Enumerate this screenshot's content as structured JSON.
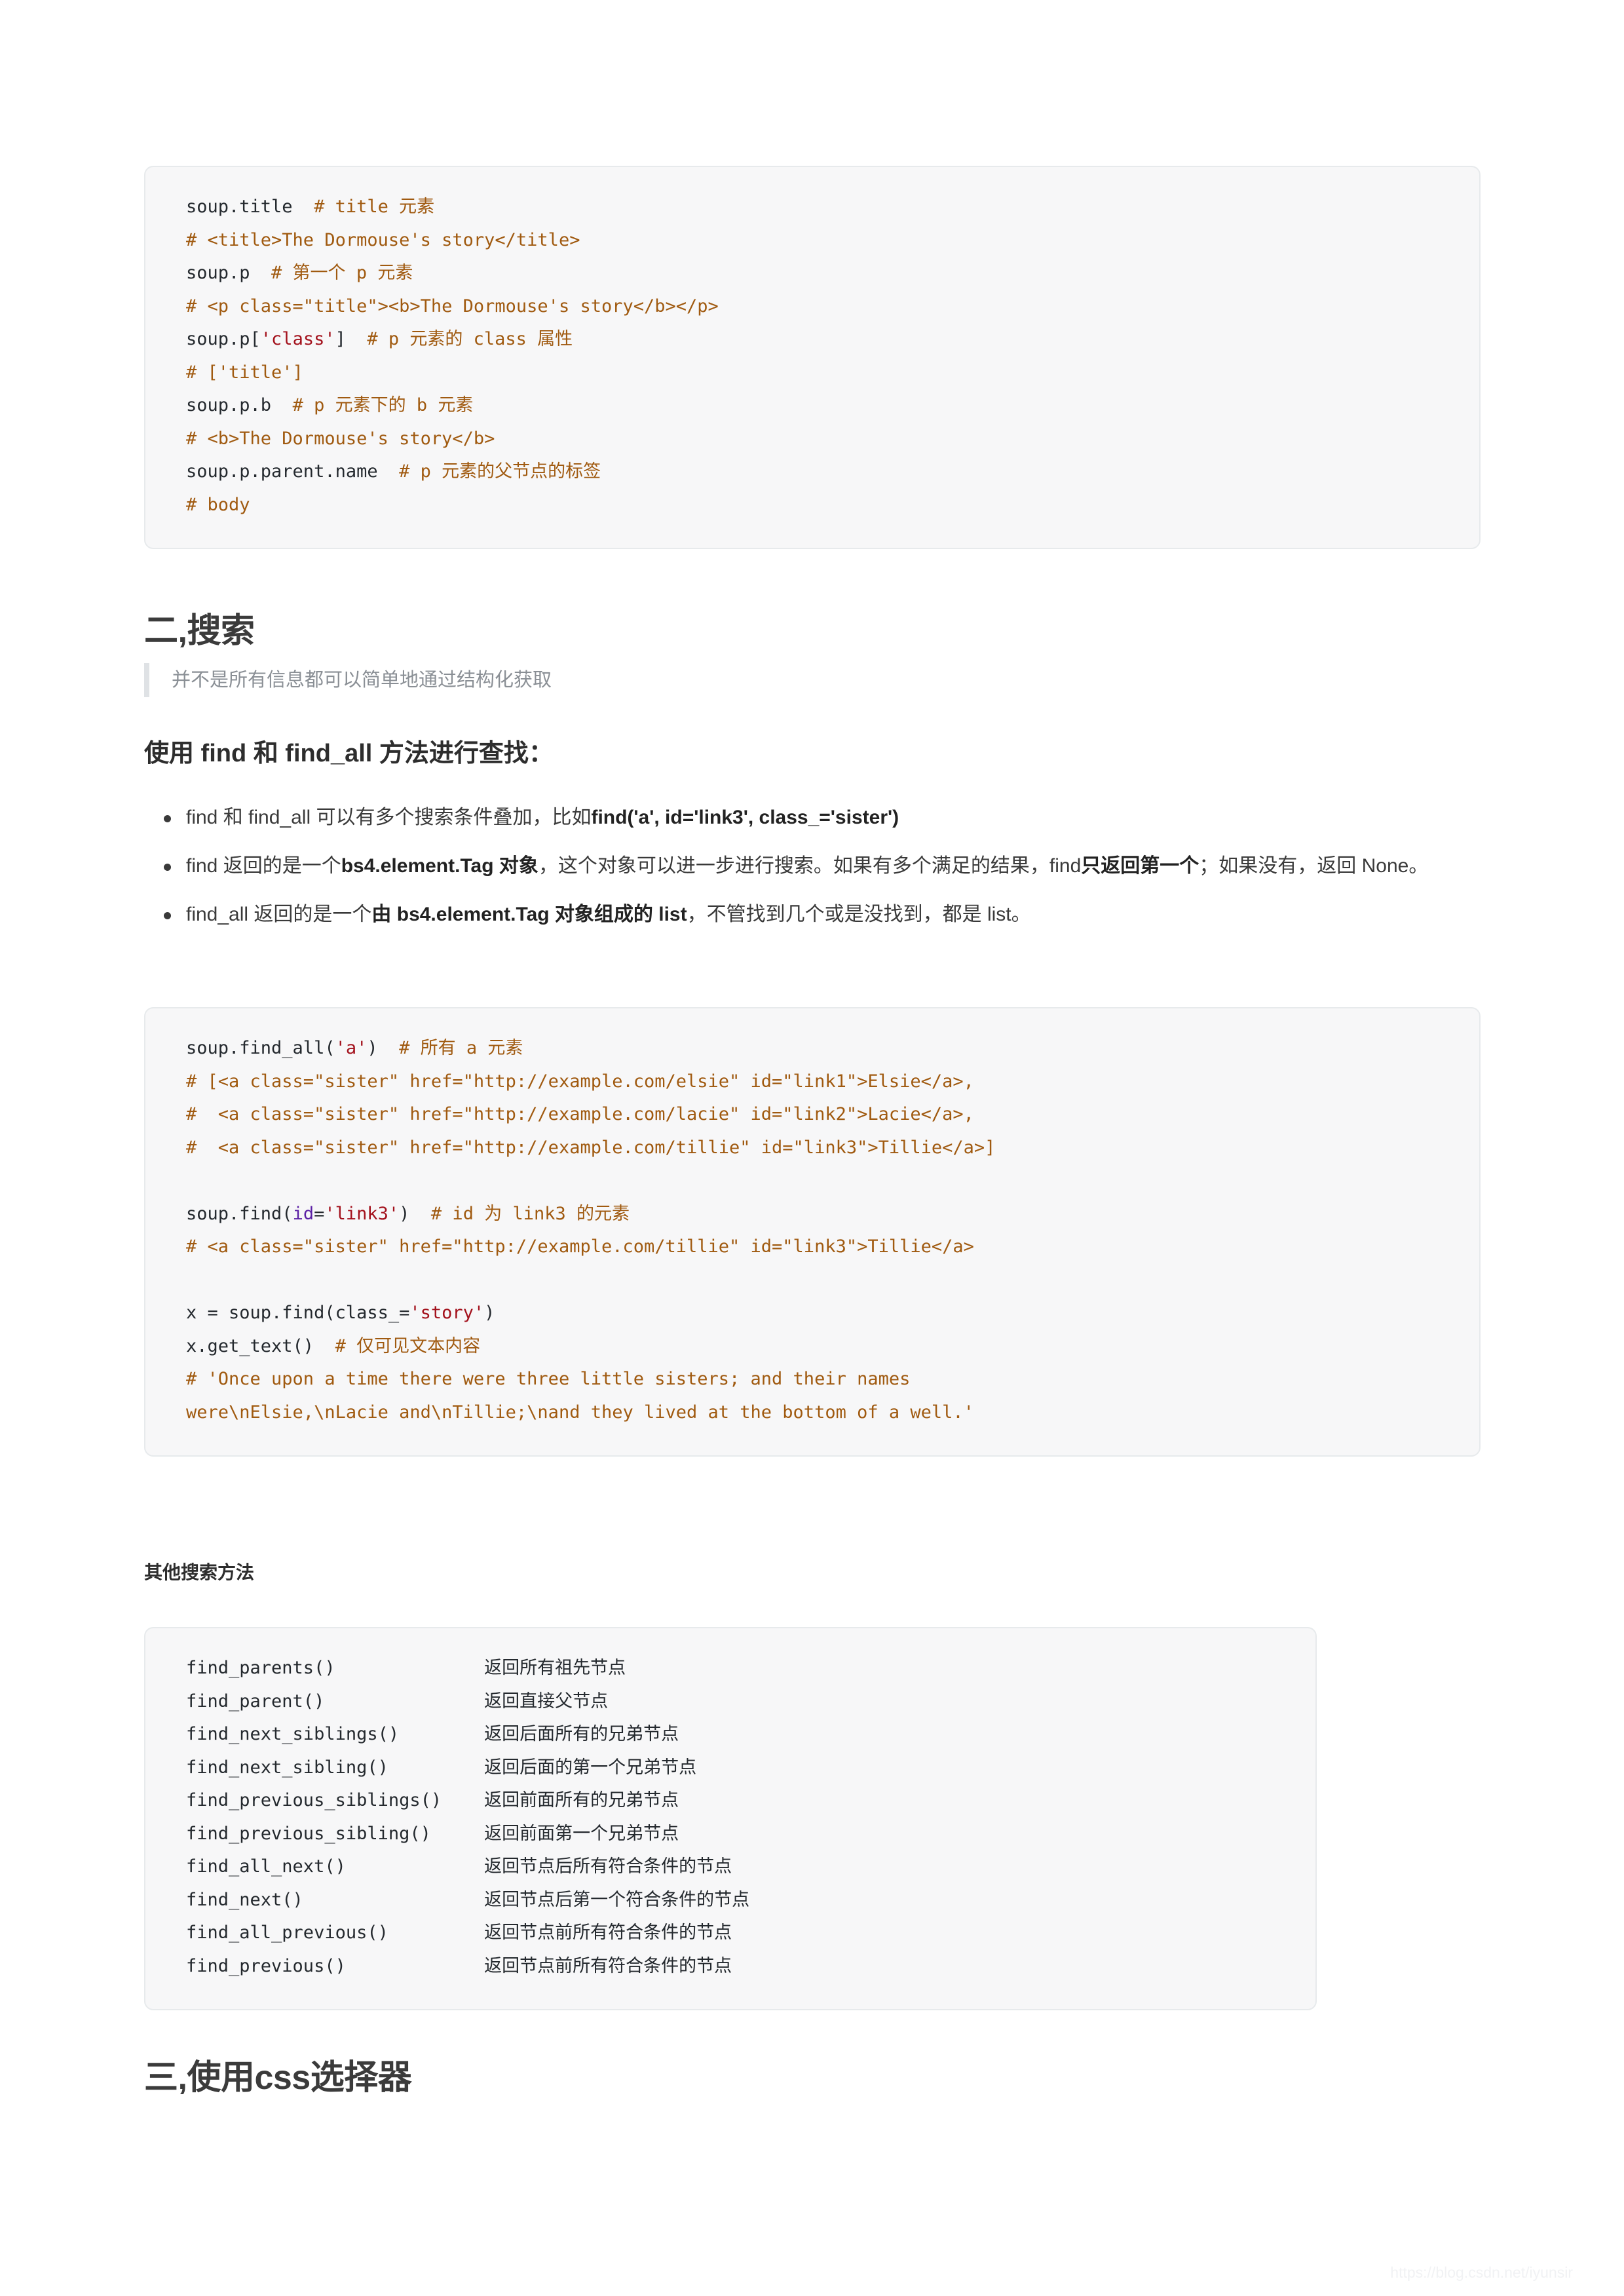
{
  "code_block_1": {
    "lines": [
      [
        {
          "t": "soup.title  ",
          "c": "plain"
        },
        {
          "t": "# title 元素",
          "c": "comment"
        }
      ],
      [
        {
          "t": "# <title>The Dormouse's story</title>",
          "c": "comment"
        }
      ],
      [
        {
          "t": "soup.p  ",
          "c": "plain"
        },
        {
          "t": "# 第一个 p 元素",
          "c": "comment"
        }
      ],
      [
        {
          "t": "# <p class=\"title\"><b>The Dormouse's story</b></p>",
          "c": "comment"
        }
      ],
      [
        {
          "t": "soup.p[",
          "c": "plain"
        },
        {
          "t": "'class'",
          "c": "string"
        },
        {
          "t": "]  ",
          "c": "plain"
        },
        {
          "t": "# p 元素的 class 属性",
          "c": "comment"
        }
      ],
      [
        {
          "t": "# ['title']",
          "c": "comment"
        }
      ],
      [
        {
          "t": "soup.p.b  ",
          "c": "plain"
        },
        {
          "t": "# p 元素下的 b 元素",
          "c": "comment"
        }
      ],
      [
        {
          "t": "# <b>The Dormouse's story</b>",
          "c": "comment"
        }
      ],
      [
        {
          "t": "soup.p.parent.name  ",
          "c": "plain"
        },
        {
          "t": "# p 元素的父节点的标签",
          "c": "comment"
        }
      ],
      [
        {
          "t": "# body",
          "c": "comment"
        }
      ]
    ]
  },
  "section_two": {
    "heading": "二,搜索",
    "quote": "并不是所有信息都可以简单地通过结构化获取",
    "sub_heading": "使用 find 和 find_all 方法进行查找："
  },
  "bullets": [
    [
      {
        "t": "find 和 find_all 可以有多个搜索条件叠加，比如",
        "b": false
      },
      {
        "t": "find('a', id='link3', class_='sister')",
        "b": true
      }
    ],
    [
      {
        "t": "find 返回的是一个",
        "b": false
      },
      {
        "t": "bs4.element.Tag 对象",
        "b": true
      },
      {
        "t": "，这个对象可以进一步进行搜索。如果有多个满足的结果，find",
        "b": false
      },
      {
        "t": "只返回第一个",
        "b": true
      },
      {
        "t": "；如果没有，返回 None。",
        "b": false
      }
    ],
    [
      {
        "t": "find_all 返回的是一个",
        "b": false
      },
      {
        "t": "由 bs4.element.Tag 对象组成的 list",
        "b": true
      },
      {
        "t": "，不管找到几个或是没找到，都是 list。",
        "b": false
      }
    ]
  ],
  "code_block_2": {
    "lines": [
      [
        {
          "t": "soup.find_all(",
          "c": "plain"
        },
        {
          "t": "'a'",
          "c": "string"
        },
        {
          "t": ")  ",
          "c": "plain"
        },
        {
          "t": "# 所有 a 元素",
          "c": "comment"
        }
      ],
      [
        {
          "t": "# [<a class=\"sister\" href=\"http://example.com/elsie\" id=\"link1\">Elsie</a>,",
          "c": "comment"
        }
      ],
      [
        {
          "t": "#  <a class=\"sister\" href=\"http://example.com/lacie\" id=\"link2\">Lacie</a>,",
          "c": "comment"
        }
      ],
      [
        {
          "t": "#  <a class=\"sister\" href=\"http://example.com/tillie\" id=\"link3\">Tillie</a>]",
          "c": "comment"
        }
      ],
      [],
      [
        {
          "t": "soup.find(",
          "c": "plain"
        },
        {
          "t": "id",
          "c": "kwarg"
        },
        {
          "t": "=",
          "c": "plain"
        },
        {
          "t": "'link3'",
          "c": "string"
        },
        {
          "t": ")  ",
          "c": "plain"
        },
        {
          "t": "# id 为 link3 的元素",
          "c": "comment"
        }
      ],
      [
        {
          "t": "# <a class=\"sister\" href=\"http://example.com/tillie\" id=\"link3\">Tillie</a>",
          "c": "comment"
        }
      ],
      [],
      [
        {
          "t": "x = soup.find(class_=",
          "c": "plain"
        },
        {
          "t": "'story'",
          "c": "string"
        },
        {
          "t": ")",
          "c": "plain"
        }
      ],
      [
        {
          "t": "x.get_text()  ",
          "c": "plain"
        },
        {
          "t": "# 仅可见文本内容",
          "c": "comment"
        }
      ],
      [
        {
          "t": "# 'Once upon a time there were three little sisters; and their names",
          "c": "comment"
        }
      ],
      [
        {
          "t": "were\\nElsie,\\nLacie and\\nTillie;\\nand they lived at the bottom of a well.'",
          "c": "comment"
        }
      ]
    ]
  },
  "minor_heading": "其他搜索方法",
  "code_block_3": {
    "rows": [
      {
        "method": "find_parents()",
        "desc": "返回所有祖先节点"
      },
      {
        "method": "find_parent()",
        "desc": "返回直接父节点"
      },
      {
        "method": "find_next_siblings()",
        "desc": "返回后面所有的兄弟节点"
      },
      {
        "method": "find_next_sibling()",
        "desc": "返回后面的第一个兄弟节点"
      },
      {
        "method": "find_previous_siblings()",
        "desc": "返回前面所有的兄弟节点"
      },
      {
        "method": "find_previous_sibling()",
        "desc": "返回前面第一个兄弟节点"
      },
      {
        "method": "find_all_next()",
        "desc": "返回节点后所有符合条件的节点"
      },
      {
        "method": "find_next()",
        "desc": "返回节点后第一个符合条件的节点"
      },
      {
        "method": "find_all_previous()",
        "desc": "返回节点前所有符合条件的节点"
      },
      {
        "method": "find_previous()",
        "desc": "返回节点前所有符合条件的节点"
      }
    ]
  },
  "section_three": {
    "heading": "三,使用css选择器"
  },
  "watermark": "https://blog.csdn.net/iyunsir",
  "colors": {
    "code_background": "#f7f7f8",
    "code_border": "#e7eaec",
    "comment": "#a05a10",
    "string": "#a3111c",
    "kwarg": "#5c21a5",
    "plain": "#24292e",
    "quote_border": "#dfe2e5",
    "quote_text": "#8a8f95",
    "heading": "#3b3b3b"
  }
}
